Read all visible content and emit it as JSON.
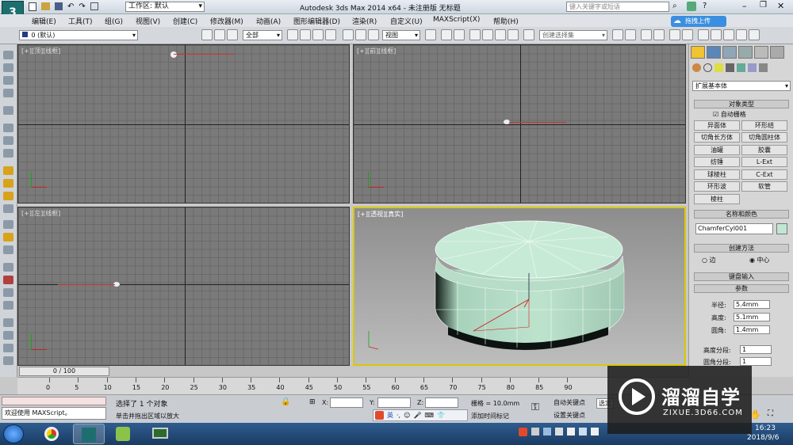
{
  "titlebar": {
    "workspace": "工作区: 默认",
    "title": "Autodesk 3ds Max  2014 x64   - 未注册版    无标题",
    "search_placeholder": "键入关键字或短语"
  },
  "menu": [
    "编辑(E)",
    "工具(T)",
    "组(G)",
    "视图(V)",
    "创建(C)",
    "修改器(M)",
    "动画(A)",
    "图形编辑器(D)",
    "渲染(R)",
    "自定义(U)",
    "MAXScript(X)",
    "帮助(H)"
  ],
  "toolbar": {
    "layer": "0 (默认)",
    "filter": "全部",
    "view": "视图",
    "selection_set": "创建选择集",
    "upload_label": "拖拽上传"
  },
  "viewports": {
    "top": "[+][顶][线框]",
    "front": "[+][前][线框]",
    "left": "[+][左][线框]",
    "perspective": "[+][透视][真实]"
  },
  "command_panel": {
    "dropdown": "扩展基本体",
    "rollout_object_type": "对象类型",
    "auto_grid": "自动栅格",
    "buttons": [
      "异面体",
      "环形结",
      "切角长方体",
      "切角圆柱体",
      "油罐",
      "胶囊",
      "纺锤",
      "L-Ext",
      "球棱柱",
      "C-Ext",
      "环形波",
      "软管",
      "棱柱"
    ],
    "rollout_name_color": "名称和颜色",
    "object_name": "ChamferCyl001",
    "rollout_creation": "创建方法",
    "radio_edge": "边",
    "radio_center": "中心",
    "rollout_keyboard": "键盘输入",
    "rollout_params": "参数",
    "param_radius_label": "半径:",
    "param_radius": "5.4mm",
    "param_height_label": "高度:",
    "param_height": "5.1mm",
    "param_fillet_label": "圆角:",
    "param_fillet": "1.4mm",
    "param_hsegs_label": "高度分段:",
    "param_hsegs": "1",
    "param_fsegs_label": "圆角分段:",
    "param_fsegs": "1"
  },
  "timeline": {
    "frame": "0 / 100",
    "ticks": [
      "0",
      "5",
      "10",
      "15",
      "20",
      "25",
      "30",
      "35",
      "40",
      "45",
      "50",
      "55",
      "60",
      "65",
      "70",
      "75",
      "80",
      "85",
      "90"
    ]
  },
  "status": {
    "maxscript": "欢迎使用  MAXScript。",
    "selected": "选择了 1 个对象",
    "prompt": "单击并拖出区域以放大",
    "x_label": "X:",
    "y_label": "Y:",
    "z_label": "Z:",
    "grid": "栅格 = 10.0mm",
    "auto_key": "自动关键点",
    "set_key": "设置关键点",
    "select_short": "选定",
    "add_time_tag": "添加时间标记",
    "ime": "英"
  },
  "taskbar": {
    "time": "16:23",
    "date": "2018/9/6"
  },
  "watermark": {
    "name": "溜溜自学",
    "url": "ZIXUE.3D66.COM"
  }
}
